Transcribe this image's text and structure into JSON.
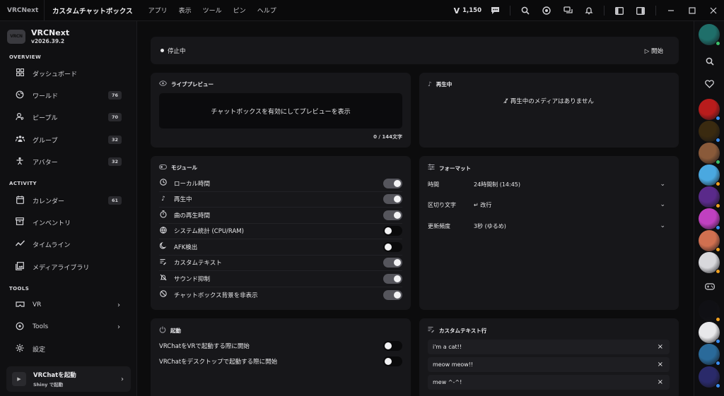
{
  "titlebar": {
    "app": "VRCNext",
    "title": "カスタムチャットボックス",
    "menu": [
      "アプリ",
      "表示",
      "ツール",
      "ピン",
      "ヘルプ"
    ],
    "credits": "1,150",
    "credits_icon": "v-icon"
  },
  "sidebar": {
    "brand_name": "VRCNext",
    "brand_logo": "VRCN",
    "version": "v2026.39.2",
    "sections": {
      "overview": "OVERVIEW",
      "activity": "ACTIVITY",
      "tools": "TOOLS"
    },
    "overview_items": [
      {
        "label": "ダッシュボード",
        "icon": "grid-icon",
        "badge": ""
      },
      {
        "label": "ワールド",
        "icon": "globe-icon",
        "badge": "76"
      },
      {
        "label": "ピープル",
        "icon": "people-icon",
        "badge": "70"
      },
      {
        "label": "グループ",
        "icon": "group-icon",
        "badge": "32"
      },
      {
        "label": "アバター",
        "icon": "avatar-icon",
        "badge": "32"
      }
    ],
    "activity_items": [
      {
        "label": "カレンダー",
        "icon": "calendar-icon",
        "badge": "61"
      },
      {
        "label": "インベントリ",
        "icon": "inventory-icon",
        "badge": ""
      },
      {
        "label": "タイムライン",
        "icon": "timeline-icon",
        "badge": ""
      },
      {
        "label": "メディアライブラリ",
        "icon": "media-icon",
        "badge": ""
      }
    ],
    "tools_items": [
      {
        "label": "VR",
        "icon": "vr-icon"
      },
      {
        "label": "Tools",
        "icon": "tools-icon"
      },
      {
        "label": "設定",
        "icon": "gear-icon"
      }
    ],
    "launch": {
      "title": "VRChatを起動",
      "subtitle": "Shiny で起動"
    }
  },
  "status": {
    "text": "停止中",
    "start_label": "開始"
  },
  "preview": {
    "title": "ライブプレビュー",
    "placeholder": "チャットボックスを有効にしてプレビューを表示",
    "count": "0 / 144文字"
  },
  "now_playing": {
    "title": "再生中",
    "empty": "再生中のメディアはありません"
  },
  "modules": {
    "title": "モジュール",
    "items": [
      {
        "label": "ローカル時間",
        "icon": "clock-icon",
        "on": true
      },
      {
        "label": "再生中",
        "icon": "music-note-icon",
        "on": true
      },
      {
        "label": "曲の再生時間",
        "icon": "stopwatch-icon",
        "on": true
      },
      {
        "label": "システム統計 (CPU/RAM)",
        "icon": "cpu-icon",
        "on": false
      },
      {
        "label": "AFK検出",
        "icon": "moon-icon",
        "on": false
      },
      {
        "label": "カスタムテキスト",
        "icon": "text-icon",
        "on": true
      },
      {
        "label": "サウンド抑制",
        "icon": "mute-icon",
        "on": true
      },
      {
        "label": "チャットボックス背景を非表示",
        "icon": "hide-icon",
        "on": true
      }
    ]
  },
  "format": {
    "title": "フォーマット",
    "rows": [
      {
        "key": "時間",
        "value": "24時間制 (14:45)"
      },
      {
        "key": "区切り文字",
        "value": "↵ 改行"
      },
      {
        "key": "更新頻度",
        "value": "3秒 (ゆるめ)"
      }
    ]
  },
  "startup": {
    "title": "起動",
    "rows": [
      {
        "label": "VRChatをVRで起動する際に開始",
        "on": false
      },
      {
        "label": "VRChatをデスクトップで起動する際に開始",
        "on": false
      }
    ]
  },
  "custom_text": {
    "title": "カスタムテキスト行",
    "lines": [
      "i'm a cat!!",
      "meow meow!!",
      "mew ^-^!"
    ]
  },
  "rail": {
    "avatars": [
      {
        "color": "#1f6f6a",
        "status": "#3bbf6a"
      },
      {
        "color": "#b81c1c",
        "status": "#3a8df0"
      },
      {
        "color": "#3a2a10",
        "status": "#3a8df0"
      },
      {
        "color": "#8a5a3a",
        "status": "#3bbf6a"
      },
      {
        "color": "#4aa8e0",
        "status": "#f0a020"
      },
      {
        "color": "#5a2a8a",
        "status": "#f0a020"
      },
      {
        "color": "#c040c0",
        "status": "#3a8df0"
      },
      {
        "color": "#d07050",
        "status": "#f0a020"
      },
      {
        "color": "#d8d8dc",
        "status": "#f0a020"
      },
      {
        "color": "#101014",
        "status": "#f0a020"
      },
      {
        "color": "#e8e8ea",
        "status": "#3a8df0"
      },
      {
        "color": "#2a6a9a",
        "status": "#3a8df0"
      },
      {
        "color": "#2a2a6a",
        "status": "#3a8df0"
      }
    ]
  }
}
